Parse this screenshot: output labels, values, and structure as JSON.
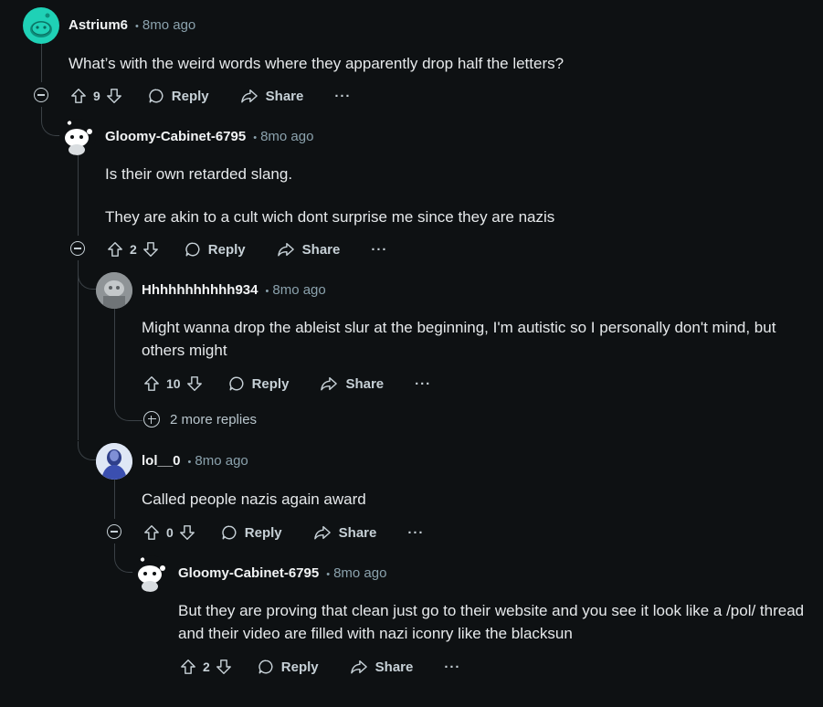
{
  "comments": [
    {
      "username": "Astrium6",
      "time": "8mo ago",
      "avatar_icon": "snoo-teal-avatar-icon",
      "body": [
        "What’s with the weird words where they apparently drop half the letters?"
      ],
      "votes": "9",
      "reply_label": "Reply",
      "share_label": "Share",
      "more_label": "···"
    },
    {
      "username": "Gloomy-Cabinet-6795",
      "time": "8mo ago",
      "avatar_icon": "snoo-default-avatar-icon",
      "body": [
        "Is their own retarded slang.",
        "They are akin to a cult wich dont surprise me since they are nazis"
      ],
      "votes": "2",
      "reply_label": "Reply",
      "share_label": "Share",
      "more_label": "···"
    },
    {
      "username": "Hhhhhhhhhhh934",
      "time": "8mo ago",
      "avatar_icon": "grey-photo-avatar-icon",
      "body": [
        "Might wanna drop the ableist slur at the beginning, I'm autistic so I personally don't mind, but",
        "others might"
      ],
      "votes": "10",
      "reply_label": "Reply",
      "share_label": "Share",
      "more_label": "···",
      "more_replies": "2 more replies"
    },
    {
      "username": "lol__0",
      "time": "8mo ago",
      "avatar_icon": "blue-photo-avatar-icon",
      "body": [
        "Called people nazis again award"
      ],
      "votes": "0",
      "reply_label": "Reply",
      "share_label": "Share",
      "more_label": "···"
    },
    {
      "username": "Gloomy-Cabinet-6795",
      "time": "8mo ago",
      "avatar_icon": "snoo-default-avatar-icon",
      "body": [
        "But they are proving that clean just go to their website and you see it look like a /pol/ thread",
        "and their video are filled with nazi iconry like the blacksun"
      ],
      "votes": "2",
      "reply_label": "Reply",
      "share_label": "Share",
      "more_label": "···"
    }
  ],
  "colors": {
    "background": "#0e1113",
    "thread_line": "#3b4146",
    "teal_avatar": "#1fd1b6"
  }
}
